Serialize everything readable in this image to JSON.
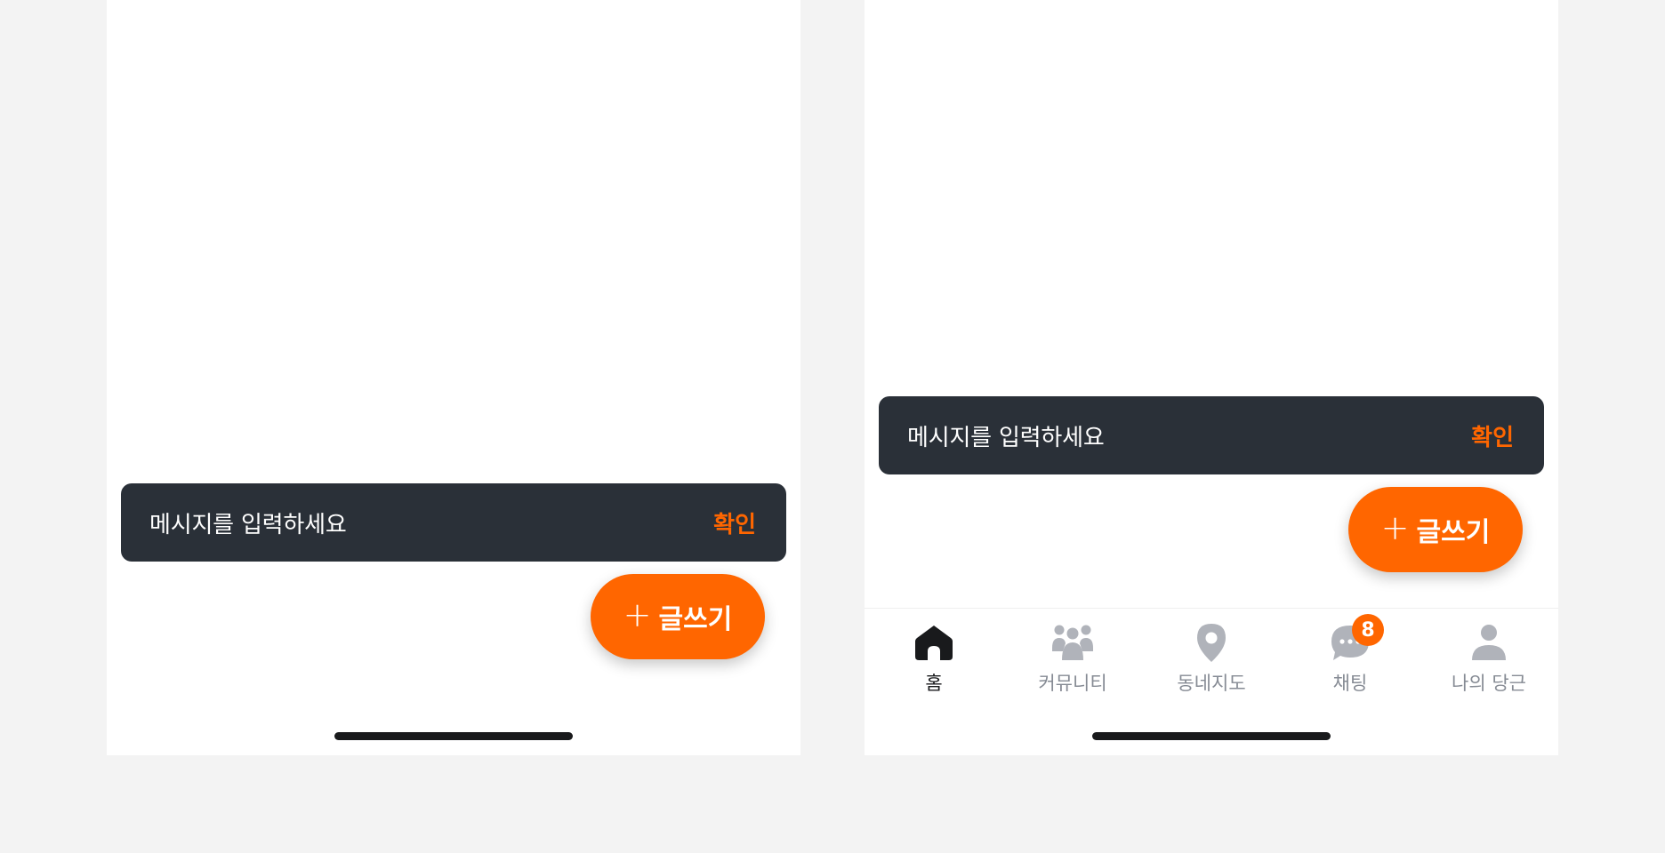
{
  "screens": [
    {
      "snackbar": {
        "message": "메시지를 입력하세요",
        "action": "확인"
      },
      "fab": {
        "plus": "+",
        "label": "글쓰기"
      }
    },
    {
      "snackbar": {
        "message": "메시지를 입력하세요",
        "action": "확인"
      },
      "fab": {
        "plus": "+",
        "label": "글쓰기"
      },
      "tabbar": {
        "items": [
          {
            "label": "홈",
            "icon": "home-icon",
            "active": true
          },
          {
            "label": "커뮤니티",
            "icon": "community-icon",
            "active": false
          },
          {
            "label": "동네지도",
            "icon": "map-pin-icon",
            "active": false
          },
          {
            "label": "채팅",
            "icon": "chat-icon",
            "active": false,
            "badge": "8"
          },
          {
            "label": "나의 당근",
            "icon": "profile-icon",
            "active": false
          }
        ]
      }
    }
  ],
  "colors": {
    "accent": "#ff6600",
    "snackbar_bg": "#2a3038",
    "tab_inactive": "#b0b3ba",
    "tab_active": "#191a1c",
    "page_bg": "#f3f3f3"
  }
}
